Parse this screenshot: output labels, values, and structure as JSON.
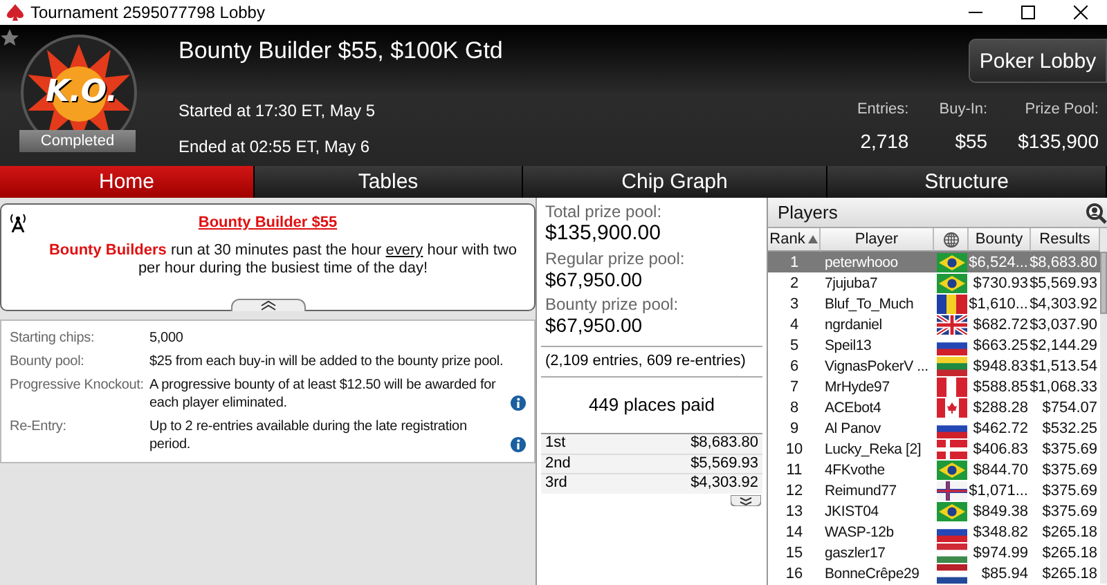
{
  "window": {
    "title": "Tournament 2595077798 Lobby"
  },
  "header": {
    "logo_text": "K.O.",
    "status": "Completed",
    "title": "Bounty Builder $55, $100K Gtd",
    "started": "Started at 17:30 ET, May 5",
    "ended": "Ended at 02:55 ET, May 6",
    "lobby_button": "Poker Lobby",
    "stats": [
      {
        "label": "Entries:",
        "value": "2,718"
      },
      {
        "label": "Buy-In:",
        "value": "$55"
      },
      {
        "label": "Prize Pool:",
        "value": "$135,900"
      }
    ]
  },
  "tabs": [
    {
      "label": "Home",
      "selected": true
    },
    {
      "label": "Tables",
      "selected": false
    },
    {
      "label": "Chip Graph",
      "selected": false
    },
    {
      "label": "Structure",
      "selected": false
    }
  ],
  "promo": {
    "title": "Bounty Builder $55",
    "text": [
      {
        "kind": "highlight",
        "text": "Bounty Builders"
      },
      {
        "kind": "plain",
        "text": " run at 30 minutes past the hour "
      },
      {
        "kind": "underline",
        "text": "every"
      },
      {
        "kind": "plain",
        "text": " hour with two per hour during the busiest time of the day!"
      }
    ]
  },
  "details": [
    {
      "label": "Starting chips:",
      "value": "5,000",
      "info": false
    },
    {
      "label": "Bounty pool:",
      "value": "$25 from each buy-in will be added to the bounty prize pool.",
      "info": false
    },
    {
      "label": "Progressive Knockout:",
      "value": "A progressive bounty of at least $12.50 will be awarded for each player eliminated.",
      "info": true
    },
    {
      "label": "Re-Entry:",
      "value": "Up to 2 re-entries available during the late registration period.",
      "info": true
    }
  ],
  "prizes": {
    "pools": [
      {
        "label": "Total prize pool:",
        "value": "$135,900.00"
      },
      {
        "label": "Regular prize pool:",
        "value": "$67,950.00"
      },
      {
        "label": "Bounty prize pool:",
        "value": "$67,950.00"
      }
    ],
    "entries": "(2,109 entries, 609 re-entries)",
    "places_paid": "449 places paid",
    "payouts": [
      {
        "place": "1st",
        "amount": "$8,683.80"
      },
      {
        "place": "2nd",
        "amount": "$5,569.93"
      },
      {
        "place": "3rd",
        "amount": "$4,303.92"
      }
    ]
  },
  "players": {
    "title": "Players",
    "columns": [
      "Rank",
      "Player",
      "Bounty",
      "Results"
    ],
    "rows": [
      {
        "rank": "1",
        "player": "peterwhooo",
        "flag": {
          "kind": "brazil"
        },
        "bounty": "$6,524...",
        "results": "$8,683.80",
        "selected": true
      },
      {
        "rank": "2",
        "player": "7jujuba7",
        "flag": {
          "kind": "brazil"
        },
        "bounty": "$730.93",
        "results": "$5,569.93",
        "selected": false
      },
      {
        "rank": "3",
        "player": "Bluf_To_Much",
        "flag": {
          "kind": "moldova"
        },
        "bounty": "$1,610...",
        "results": "$4,303.92",
        "selected": false
      },
      {
        "rank": "4",
        "player": "ngrdaniel",
        "flag": {
          "kind": "uk"
        },
        "bounty": "$682.72",
        "results": "$3,037.90",
        "selected": false
      },
      {
        "rank": "5",
        "player": "Speil13",
        "flag": {
          "kind": "russia"
        },
        "bounty": "$663.25",
        "results": "$2,144.29",
        "selected": false
      },
      {
        "rank": "6",
        "player": "VignasPokerV ...",
        "flag": {
          "kind": "lithuania"
        },
        "bounty": "$948.83",
        "results": "$1,513.54",
        "selected": false
      },
      {
        "rank": "7",
        "player": "MrHyde97",
        "flag": {
          "kind": "peru"
        },
        "bounty": "$588.85",
        "results": "$1,068.33",
        "selected": false
      },
      {
        "rank": "8",
        "player": "ACEbot4",
        "flag": {
          "kind": "canada"
        },
        "bounty": "$288.28",
        "results": "$754.07",
        "selected": false
      },
      {
        "rank": "9",
        "player": "Al Panov",
        "flag": {
          "kind": "russia"
        },
        "bounty": "$462.72",
        "results": "$532.25",
        "selected": false
      },
      {
        "rank": "10",
        "player": "Lucky_Reka [2]",
        "flag": {
          "kind": "denmark"
        },
        "bounty": "$406.83",
        "results": "$375.69",
        "selected": false
      },
      {
        "rank": "11",
        "player": "4FKvothe",
        "flag": {
          "kind": "brazil"
        },
        "bounty": "$844.70",
        "results": "$375.69",
        "selected": false
      },
      {
        "rank": "12",
        "player": "Reimund77",
        "flag": {
          "kind": "faroe"
        },
        "bounty": "$1,071...",
        "results": "$375.69",
        "selected": false
      },
      {
        "rank": "13",
        "player": "JKIST04",
        "flag": {
          "kind": "brazil"
        },
        "bounty": "$849.38",
        "results": "$375.69",
        "selected": false
      },
      {
        "rank": "14",
        "player": "WASP-12b",
        "flag": {
          "kind": "russia"
        },
        "bounty": "$348.82",
        "results": "$265.18",
        "selected": false
      },
      {
        "rank": "15",
        "player": "gaszler17",
        "flag": {
          "kind": "hungary"
        },
        "bounty": "$974.99",
        "results": "$265.18",
        "selected": false
      },
      {
        "rank": "16",
        "player": "BonneCrêpe29",
        "flag": {
          "kind": "netherlands"
        },
        "bounty": "$85.94",
        "results": "$265.18",
        "selected": false
      }
    ]
  }
}
